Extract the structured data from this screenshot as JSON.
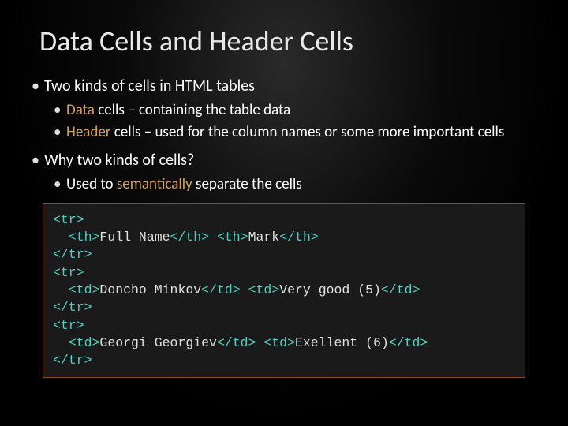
{
  "title": "Data Cells and Header Cells",
  "bullets": {
    "b1": "Two kinds of cells in HTML tables",
    "b1a_pre": "Data",
    "b1a_post": " cells – containing the table data",
    "b1b_pre": "Header",
    "b1b_post": " cells – used for the column names or some more important cells",
    "b2": "Why two kinds of cells?",
    "b2a_pre": "Used to ",
    "b2a_accent": "semantically",
    "b2a_post": " separate the cells"
  },
  "code": {
    "l1": "<tr>",
    "l2_indent": "  ",
    "l2_o1": "<th>",
    "l2_t1": "Full Name",
    "l2_c1": "</th>",
    "l2_sp": " ",
    "l2_o2": "<th>",
    "l2_t2": "Mark",
    "l2_c2": "</th>",
    "l3": "</tr>",
    "l4": "<tr>",
    "l5_indent": "  ",
    "l5_o1": "<td>",
    "l5_t1": "Doncho Minkov",
    "l5_c1": "</td>",
    "l5_sp": " ",
    "l5_o2": "<td>",
    "l5_t2": "Very good (5)",
    "l5_c2": "</td>",
    "l6": "</tr>",
    "l7": "<tr>",
    "l8_indent": "  ",
    "l8_o1": "<td>",
    "l8_t1": "Georgi Georgiev",
    "l8_c1": "</td>",
    "l8_sp": " ",
    "l8_o2": "<td>",
    "l8_t2": "Exellent (6)",
    "l8_c2": "</td>",
    "l9": "</tr>"
  }
}
